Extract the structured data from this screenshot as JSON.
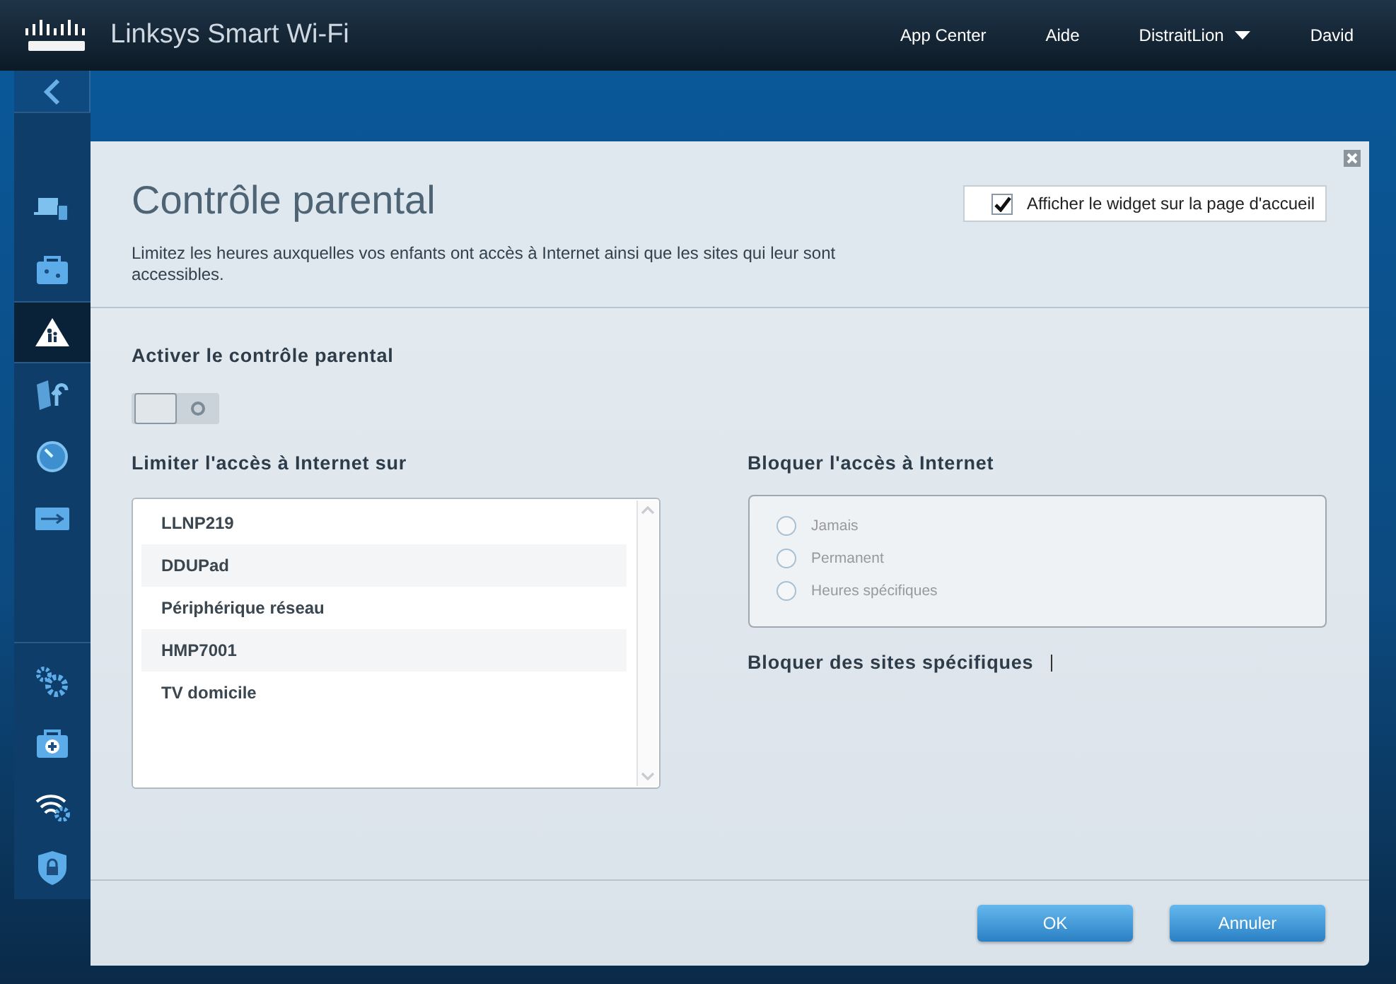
{
  "header": {
    "brand": "Linksys Smart Wi-Fi",
    "nav": [
      {
        "label": "App Center",
        "kind": "link"
      },
      {
        "label": "Aide",
        "kind": "link"
      },
      {
        "label": "DistraitLion",
        "kind": "dropdown"
      },
      {
        "label": "David",
        "kind": "link"
      }
    ]
  },
  "sidebar": {
    "groups": [
      {
        "items": [
          {
            "selected": false
          },
          {
            "selected": false
          },
          {
            "selected": true
          },
          {
            "selected": false
          },
          {
            "selected": false
          },
          {
            "selected": false
          }
        ]
      },
      {
        "items": [
          {
            "selected": false
          },
          {
            "selected": false
          },
          {
            "selected": false
          },
          {
            "selected": false
          }
        ]
      }
    ]
  },
  "dialog": {
    "title": "Contrôle parental",
    "description": "Limitez les heures auxquelles vos enfants ont accès à Internet ainsi que les sites qui leur sont accessibles.",
    "widget_checkbox": {
      "label": "Afficher le widget sur la page d'accueil",
      "checked": true
    },
    "enable": {
      "label": "Activer le contrôle parental",
      "on": false
    },
    "devices": {
      "label": "Limiter l'accès à Internet sur",
      "items": [
        {
          "name": "LLNP219"
        },
        {
          "name": "DDUPad"
        },
        {
          "name": "Périphérique réseau"
        },
        {
          "name": "HMP7001"
        },
        {
          "name": "TV domicile"
        }
      ]
    },
    "block": {
      "label": "Bloquer l'accès à Internet",
      "disabled": true,
      "options": [
        {
          "label": "Jamais",
          "selected": false
        },
        {
          "label": "Permanent",
          "selected": false
        },
        {
          "label": "Heures spécifiques",
          "selected": false
        }
      ]
    },
    "sites": {
      "label": "Bloquer des sites spécifiques"
    },
    "buttons": [
      {
        "label": "OK"
      },
      {
        "label": "Annuler"
      }
    ]
  }
}
